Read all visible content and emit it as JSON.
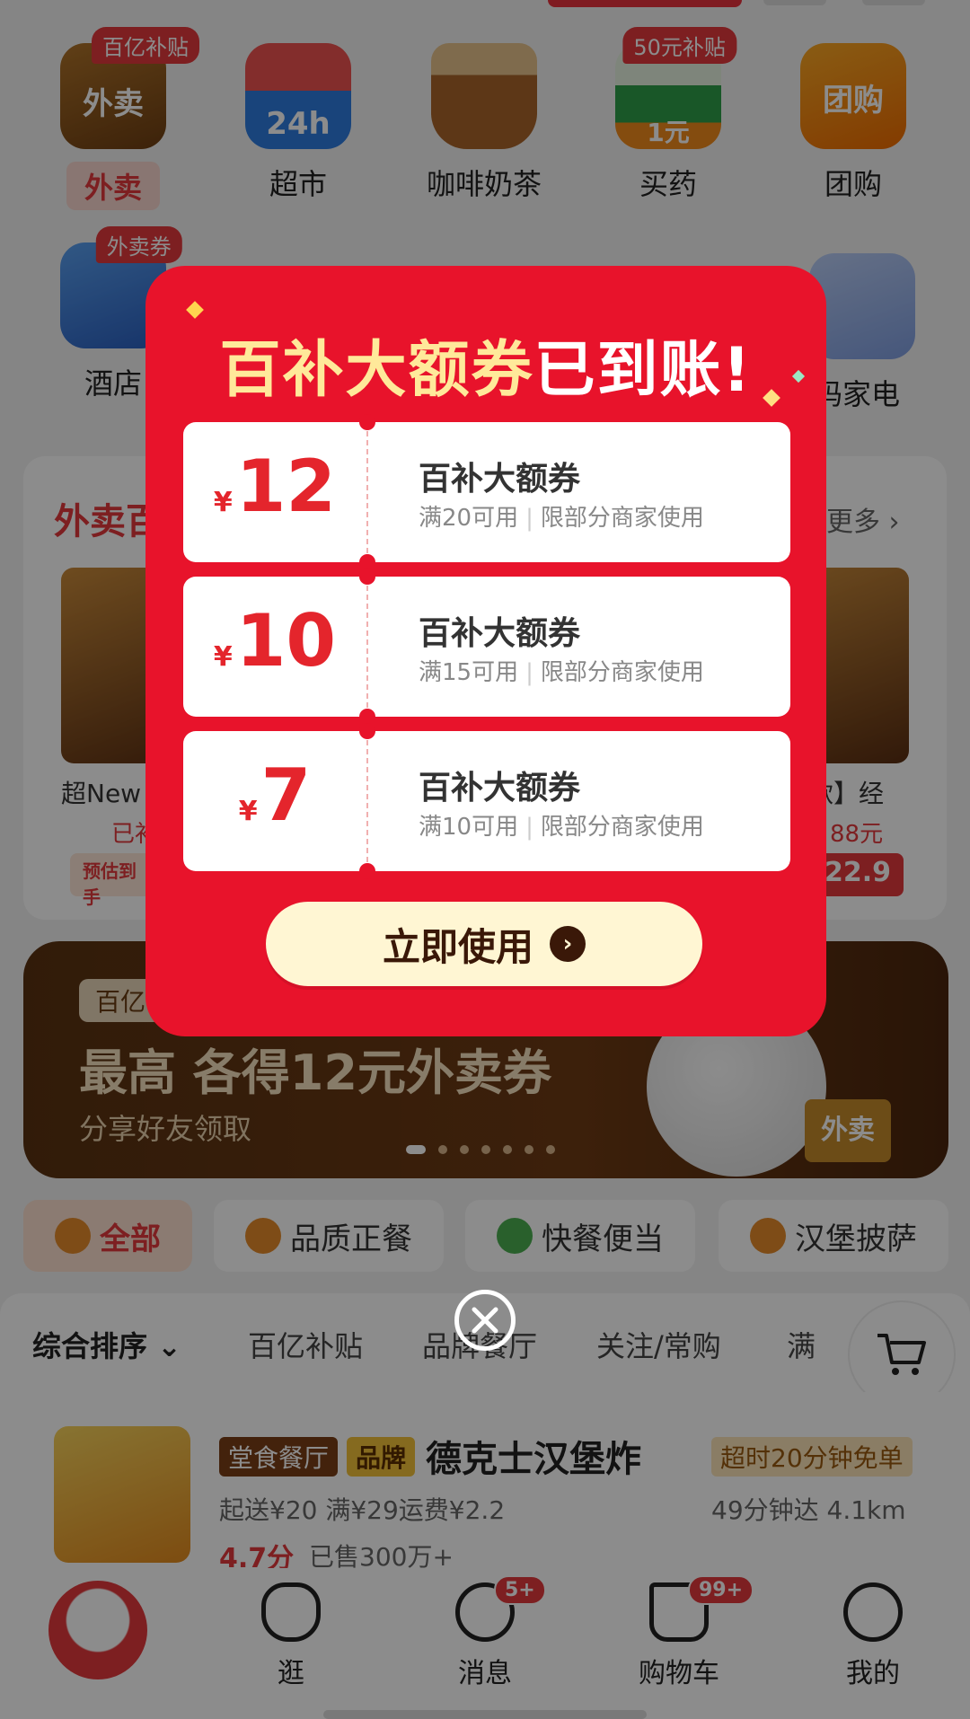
{
  "categories_row1": [
    {
      "label": "外卖",
      "icon": "takeout-icon",
      "icon_text": "外卖",
      "badge": "百亿补贴",
      "active": true
    },
    {
      "label": "超市",
      "icon": "supermarket-icon",
      "icon_text": "24h",
      "badge": "",
      "active": false
    },
    {
      "label": "咖啡奶茶",
      "icon": "coffee-icon",
      "icon_text": "",
      "badge": "",
      "active": false
    },
    {
      "label": "买药",
      "icon": "medicine-icon",
      "icon_text": "1元",
      "badge": "50元补贴",
      "active": false
    },
    {
      "label": "团购",
      "icon": "group-buy-icon",
      "icon_text": "团购",
      "badge": "",
      "active": false
    }
  ],
  "categories_row2": [
    {
      "label": "酒店",
      "icon": "hotel-icon",
      "badge": "外卖券"
    },
    {
      "label": "码家电",
      "icon": "appliance-icon",
      "badge": ""
    }
  ],
  "takeout_section": {
    "title": "外卖百",
    "more": "更多 ›",
    "left_food_name": "超New",
    "left_food_sub": "已补",
    "left_pill": "预估到手",
    "right_food_name": "款】经",
    "right_food_sub": "88元",
    "right_pill": "22.9"
  },
  "banner": {
    "tag": "百亿",
    "line1": "最高 各得12元外卖券",
    "line2": "分享好友领取",
    "bag": "外卖"
  },
  "chips": [
    {
      "label": "全部",
      "active": true
    },
    {
      "label": "品质正餐",
      "active": false
    },
    {
      "label": "快餐便当",
      "active": false
    },
    {
      "label": "汉堡披萨",
      "active": false
    }
  ],
  "filters": [
    "综合排序",
    "百亿补贴",
    "品牌餐厅",
    "关注/常购",
    "满"
  ],
  "shop": {
    "tag1": "堂食餐厅",
    "tag2": "品牌",
    "name": "德克士汉堡炸",
    "tag3": "超时20分钟免单",
    "line1": "起送¥20  满¥29运费¥2.2",
    "eta": "49分钟达  4.1km",
    "rating": "4.7分",
    "sold": "已售300万+"
  },
  "tabbar": [
    {
      "label": "逛",
      "count": ""
    },
    {
      "label": "消息",
      "count": "5+"
    },
    {
      "label": "购物车",
      "count": "99+"
    },
    {
      "label": "我的",
      "count": ""
    }
  ],
  "modal": {
    "title_yellow": "百补大额券",
    "title_white": "已到账!",
    "coupons": [
      {
        "currency": "¥",
        "amount": "12",
        "name": "百补大额券",
        "condition": "满20可用",
        "scope": "限部分商家使用"
      },
      {
        "currency": "¥",
        "amount": "10",
        "name": "百补大额券",
        "condition": "满15可用",
        "scope": "限部分商家使用"
      },
      {
        "currency": "¥",
        "amount": "7",
        "name": "百补大额券",
        "condition": "满10可用",
        "scope": "限部分商家使用"
      }
    ],
    "button": "立即使用"
  },
  "colors": {
    "modal_red": "#e8132b",
    "accent_red": "#e4393c",
    "button_cream": "#fff6d3"
  }
}
